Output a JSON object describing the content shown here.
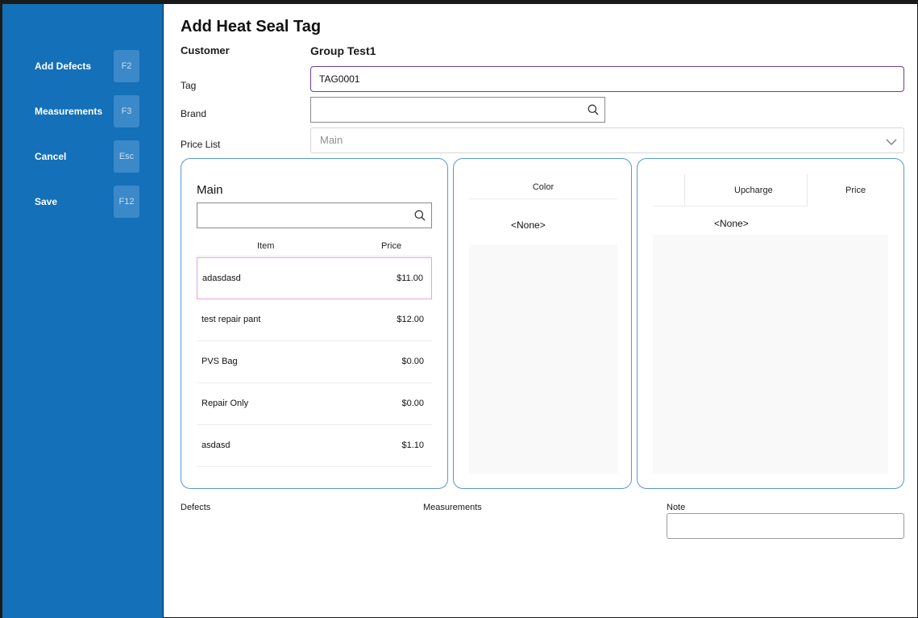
{
  "sidebar": {
    "items": [
      {
        "label": "Add Defects",
        "key": "F2"
      },
      {
        "label": "Measurements",
        "key": "F3"
      },
      {
        "label": "Cancel",
        "key": "Esc"
      },
      {
        "label": "Save",
        "key": "F12"
      }
    ],
    "bg_color": "#1470b8"
  },
  "form": {
    "title": "Add Heat Seal Tag",
    "customer_label": "Customer",
    "customer_value": "Group Test1",
    "tag_label": "Tag",
    "tag_value": "TAG0001",
    "brand_label": "Brand",
    "brand_value": "",
    "price_list_label": "Price List",
    "price_list_value": "Main"
  },
  "items_panel": {
    "title": "Main",
    "search_value": "",
    "columns": {
      "item": "Item",
      "price": "Price"
    },
    "rows": [
      {
        "name": "adasdasd",
        "price": "$11.00",
        "selected": true
      },
      {
        "name": "test repair pant",
        "price": "$12.00"
      },
      {
        "name": "PVS Bag",
        "price": "$0.00"
      },
      {
        "name": "Repair Only",
        "price": "$0.00"
      },
      {
        "name": "asdasd",
        "price": "$1.10"
      }
    ]
  },
  "color_panel": {
    "header": "Color",
    "none_option": "<None>"
  },
  "upcharge_panel": {
    "columns": {
      "upcharge": "Upcharge",
      "price": "Price"
    },
    "none_option": "<None>"
  },
  "footer": {
    "defects_label": "Defects",
    "measurements_label": "Measurements",
    "note_label": "Note",
    "note_value": ""
  },
  "colors": {
    "accent": "#1470b8",
    "panel_border": "#5a96d8",
    "tag_focus_border": "#6a3fa0",
    "selected_row_border": "#e2a6e0"
  },
  "icons": [
    "search-icon",
    "chevron-down-icon"
  ]
}
